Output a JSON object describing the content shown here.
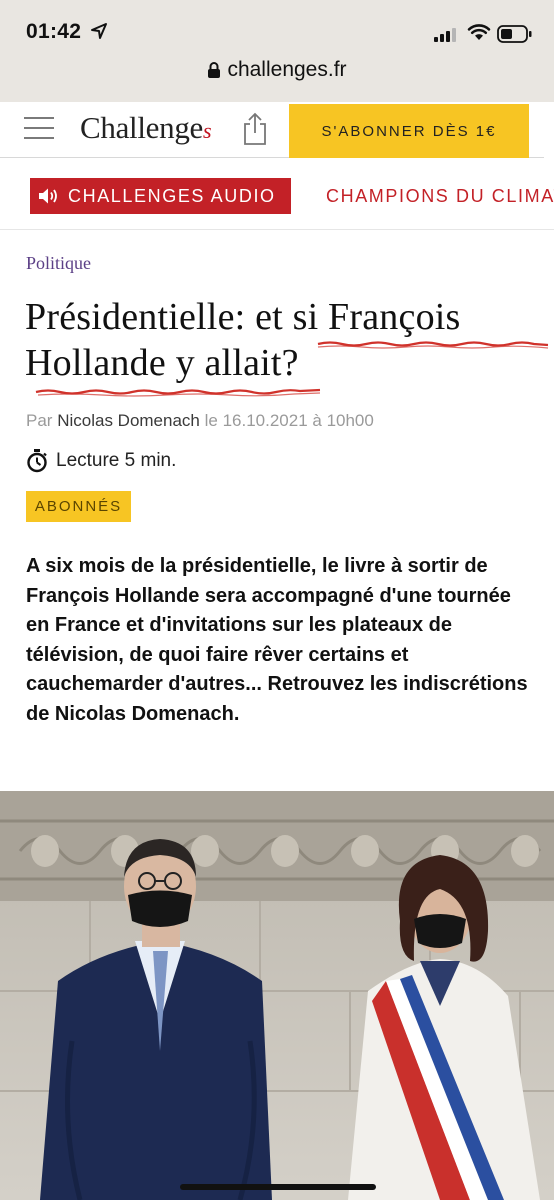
{
  "status_bar": {
    "time": "01:42",
    "icons": [
      "location-arrow-icon",
      "signal-icon",
      "wifi-icon",
      "battery-icon"
    ]
  },
  "browser": {
    "url": "challenges.fr",
    "icons": [
      "lock-icon"
    ]
  },
  "header": {
    "logo": "Challenge",
    "logo_suffix": "s",
    "subscribe_label": "S'ABONNER DÈS 1€",
    "icons": [
      "menu-icon",
      "share-icon"
    ]
  },
  "nav": {
    "audio_label": "CHALLENGES AUDIO",
    "next_tag": "CHAMPIONS DU CLIMAT",
    "icons": [
      "speaker-icon"
    ]
  },
  "article": {
    "rubric": "Politique",
    "title": "Présidentielle: et si François Hollande y allait?",
    "byline_prefix": "Par",
    "author": "Nicolas Domenach",
    "byline_date": "le 16.10.2021 à 10h00",
    "reading_time": "Lecture 5 min.",
    "badge": "ABONNÉS",
    "lead": "A six mois de la présidentielle, le livre à sortir de François Hollande sera accompagné d'une tournée en France et d'invitations sur les plateaux de télévision, de quoi faire rêver certains et cauchemarder d'autres... Retrouvez les indiscrétions de Nicolas Domenach."
  },
  "colors": {
    "brand_red": "#c32127",
    "accent_yellow": "#f7c523",
    "rubric_purple": "#5b3f86",
    "annotation_red": "#d0322b"
  }
}
